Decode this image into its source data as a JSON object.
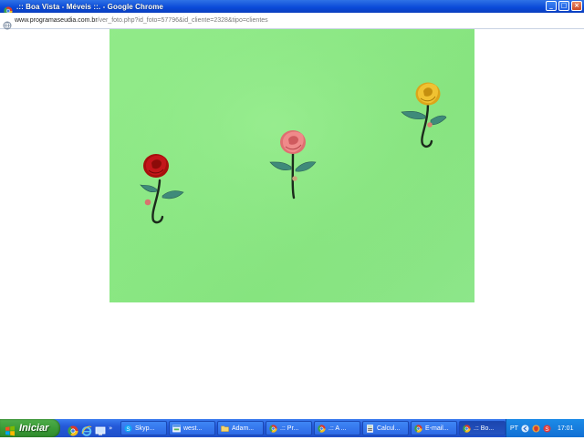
{
  "window": {
    "title": ".:: Boa Vista - Méveis ::. - Google Chrome",
    "controls": {
      "minimize": "_",
      "maximize": "□",
      "close": "×"
    }
  },
  "address_bar": {
    "host": "www.programaseudia.com.br",
    "path": "/ver_foto.php?id_foto=57796&id_cliente=2328&tipo=clientes"
  },
  "photo": {
    "description_icons": [
      "rose-hook-red",
      "rose-hook-pink",
      "rose-hook-yellow"
    ],
    "colors": {
      "wall": "#8be884",
      "red_rose": "#b0110f",
      "pink_rose": "#e8787a",
      "yellow_rose": "#e6b21c",
      "hook": "#1c2a1c",
      "leaf": "#3f8a7a"
    }
  },
  "taskbar": {
    "start_label": "Iniciar",
    "quick_launch_more": "»",
    "tasks": [
      {
        "label": "Skyp...",
        "icon": "skype-icon",
        "active": false
      },
      {
        "label": "west...",
        "icon": "window-icon",
        "active": false
      },
      {
        "label": "Adam...",
        "icon": "folder-icon",
        "active": false
      },
      {
        "label": ".:: Pr...",
        "icon": "chrome-icon",
        "active": false
      },
      {
        "label": ".:: A ...",
        "icon": "chrome-icon",
        "active": false
      },
      {
        "label": "Calcul...",
        "icon": "calculator-icon",
        "active": false
      },
      {
        "label": "E-mail...",
        "icon": "chrome-icon",
        "active": false
      },
      {
        "label": ".:: Bo...",
        "icon": "chrome-icon",
        "active": true
      }
    ],
    "tray": {
      "language": "PT",
      "clock": "17:01"
    }
  }
}
